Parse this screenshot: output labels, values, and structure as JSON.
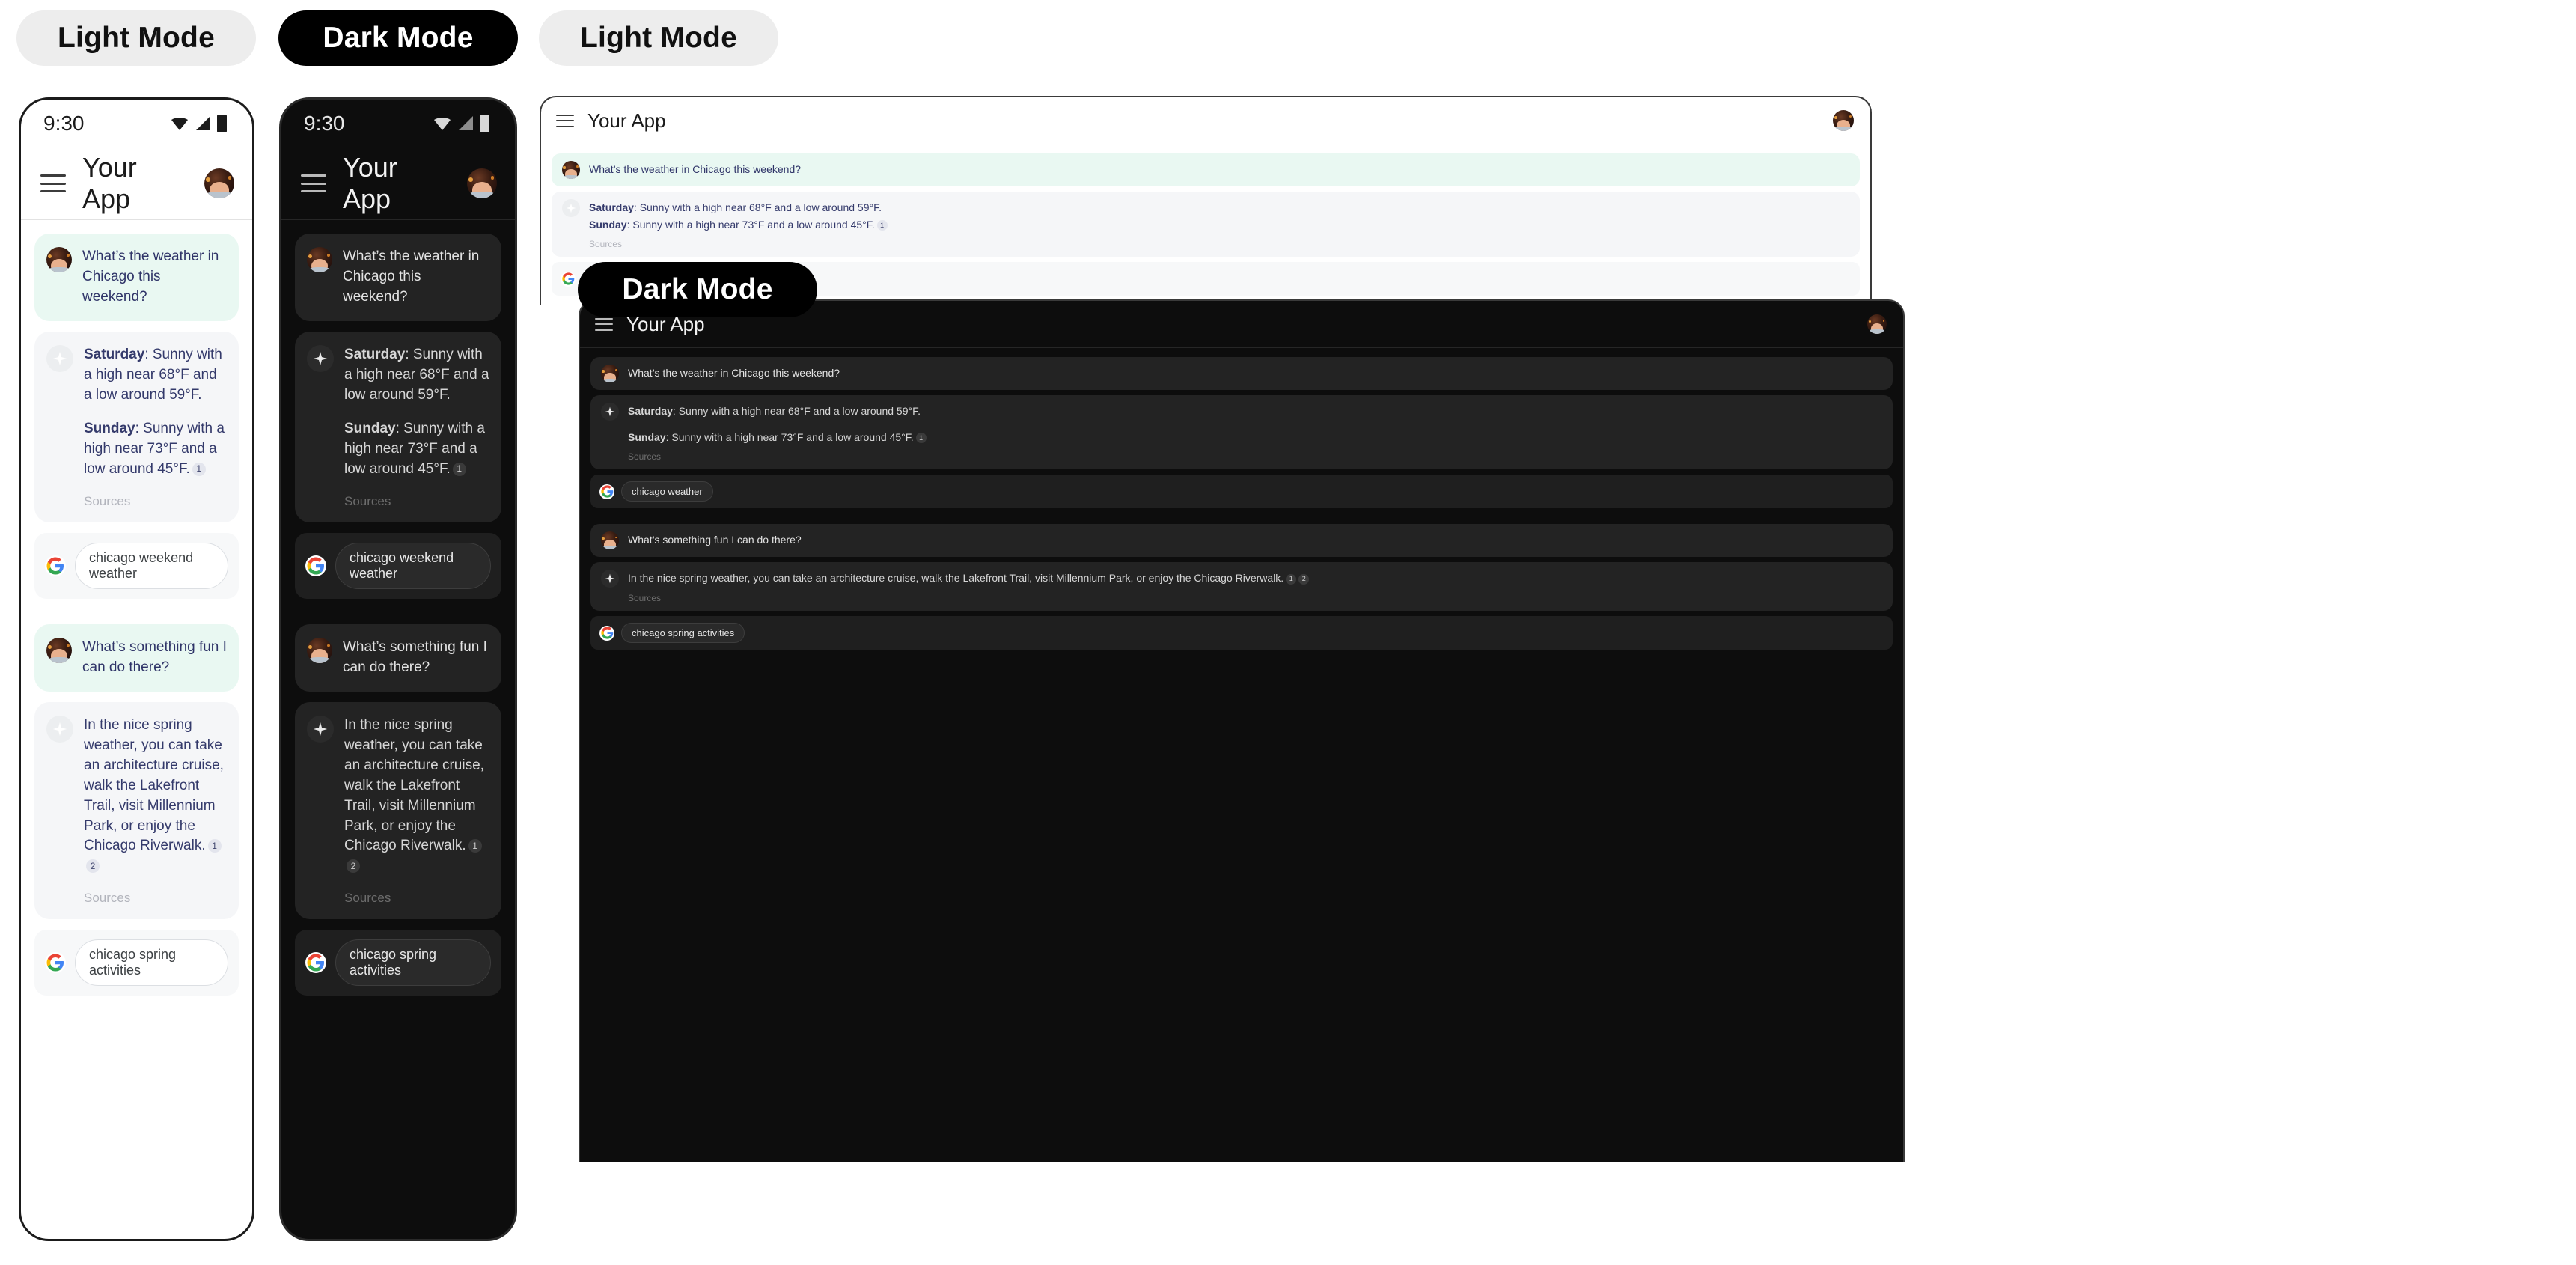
{
  "labels": {
    "light_mode": "Light Mode",
    "dark_mode": "Dark Mode"
  },
  "colors": {
    "user_bubble_light": "#e9f8f2",
    "user_text_light": "#2f3468",
    "ai_bubble_light": "#f5f6f8",
    "ai_text_light": "#343a6b",
    "bubble_dark": "#232323",
    "text_dark": "#d9d9d9",
    "surface_dark": "#0d0d0d",
    "pill_light_bg": "#ededed",
    "pill_dark_bg": "#000000",
    "google_blue": "#4285F4",
    "google_red": "#EA4335",
    "google_yellow": "#FBBC05",
    "google_green": "#34A853"
  },
  "statusbar": {
    "time": "9:30",
    "icons": [
      "wifi-icon",
      "cell-signal-icon",
      "battery-icon"
    ]
  },
  "appbar": {
    "menu_icon": "hamburger-menu-icon",
    "title": "Your App",
    "avatar": "user-avatar"
  },
  "conversation": {
    "messages": [
      {
        "role": "user",
        "text": "What’s the weather in Chicago this weekend?"
      },
      {
        "role": "assistant",
        "line1_label": "Saturday",
        "line1_text": ": Sunny with a high near 68°F and a low around 59°F.",
        "line2_label": "Sunday",
        "line2_text": ": Sunny with a high near 73°F and a low around 45°F.",
        "citations": [
          "1"
        ],
        "sources_label": "Sources"
      },
      {
        "role": "search",
        "provider_icon": "google-g-icon",
        "query": "chicago weekend weather"
      },
      {
        "role": "user",
        "text": "What’s something fun I can do there?"
      },
      {
        "role": "assistant",
        "text": "In the nice spring weather, you can take an architecture cruise, walk the Lakefront Trail, visit Millennium Park, or enjoy the Chicago Riverwalk.",
        "citations": [
          "1",
          "2"
        ],
        "sources_label": "Sources"
      },
      {
        "role": "search",
        "provider_icon": "google-g-icon",
        "query": "chicago spring activities"
      }
    ]
  },
  "wide_dark_overrides": {
    "first_query": "chicago weather"
  }
}
